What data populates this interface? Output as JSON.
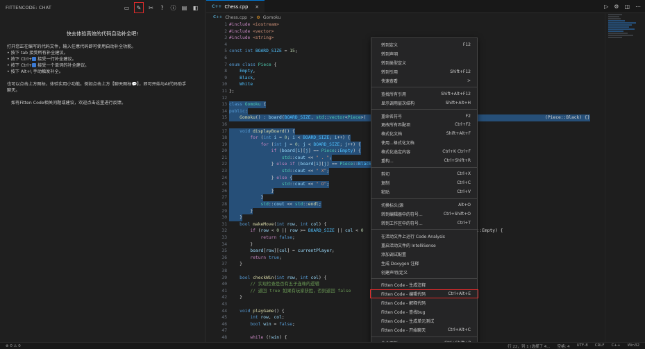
{
  "sidebar": {
    "title": "FITTENCODE: CHAT",
    "icons": [
      "chat-icon",
      "edit-icon",
      "tools-icon",
      "help-icon",
      "info-icon",
      "document-icon",
      "layout-icon"
    ],
    "welcome_title": "快去体验高效的代码自动补全吧!",
    "tips": [
      "打开您正在编写的代码文件，输入任意代码即可使用自动补全功能。",
      "• 按下 tab 接受所有补全建议。",
      "• 按下 Ctrl+",
      "• 按下 Ctrl+",
      "• 按下 Alt+\\ 手动触发补全。"
    ],
    "tip2_suffix": " 接受一行补全建议。",
    "tip3_suffix": " 接受一个单词的补全建议。",
    "feature_line1": "也可以点击上方图标，体验实用小功能。例如点击上方【聊天图标",
    "feature_line1_suffix": "】，即可开始与AI代码助手",
    "feature_line2": "聊天。",
    "feedback": "如有Fitten Code相关问题或建议，欢迎点击这里进行反馈。"
  },
  "editor": {
    "tab_icon": "C++",
    "tab_label": "Chess.cpp",
    "breadcrumb_icon": "C++",
    "breadcrumb_file": "Chess.cpp",
    "breadcrumb_sep": ">",
    "breadcrumb_symbol": "Gomoku",
    "code_tail_line15": "(Piece::Black) {}",
    "code_tail_line32": "= Piece::Empty) {"
  },
  "context_menu": {
    "items": [
      {
        "label": "转到定义",
        "key": "F12"
      },
      {
        "label": "转到声明",
        "key": ""
      },
      {
        "label": "转到类型定义",
        "key": ""
      },
      {
        "label": "转到引用",
        "key": "Shift+F12"
      },
      {
        "label": "快速查看",
        "key": ">"
      },
      {
        "sep": true
      },
      {
        "label": "查找所有引用",
        "key": "Shift+Alt+F12"
      },
      {
        "label": "显示调用层次结构",
        "key": "Shift+Alt+H"
      },
      {
        "sep": true
      },
      {
        "label": "重命名符号",
        "key": "F2"
      },
      {
        "label": "更改所有匹配项",
        "key": "Ctrl+F2"
      },
      {
        "label": "格式化文档",
        "key": "Shift+Alt+F"
      },
      {
        "label": "使用...格式化文档",
        "key": ""
      },
      {
        "label": "格式化选定内容",
        "key": "Ctrl+K Ctrl+F"
      },
      {
        "label": "重构...",
        "key": "Ctrl+Shift+R"
      },
      {
        "sep": true
      },
      {
        "label": "剪切",
        "key": "Ctrl+X"
      },
      {
        "label": "复制",
        "key": "Ctrl+C"
      },
      {
        "label": "粘贴",
        "key": "Ctrl+V"
      },
      {
        "sep": true
      },
      {
        "label": "切换标头/源",
        "key": "Alt+O"
      },
      {
        "label": "转到编辑器中的符号...",
        "key": "Ctrl+Shift+O"
      },
      {
        "label": "转到工作区中的符号...",
        "key": "Ctrl+T"
      },
      {
        "sep": true
      },
      {
        "label": "在活动文件上运行 Code Analysis",
        "key": ""
      },
      {
        "label": "重启活动文件的 IntelliSense",
        "key": ""
      },
      {
        "label": "添加调试配置",
        "key": ""
      },
      {
        "label": "生成 Doxygen 注释",
        "key": ""
      },
      {
        "label": "创建声明/定义",
        "key": ""
      },
      {
        "sep": true
      },
      {
        "label": "Fitten Code - 生成注释",
        "key": ""
      },
      {
        "label": "Fitten Code - 编辑代码",
        "key": "Ctrl+Alt+E",
        "highlight": true
      },
      {
        "label": "Fitten Code - 解释代码",
        "key": ""
      },
      {
        "label": "Fitten Code - 查找bug",
        "key": ""
      },
      {
        "label": "Fitten Code - 生成单元测试",
        "key": ""
      },
      {
        "label": "Fitten Code - 开始聊天",
        "key": "Ctrl+Alt+C"
      },
      {
        "sep": true
      },
      {
        "label": "命令面板...",
        "key": "Ctrl+Shift+P"
      }
    ]
  },
  "statusbar": {
    "left": "⊗ 0 ⚠ 0",
    "right": [
      "行 22，列 1 (选择了 4...",
      "空格: 4",
      "UTF-8",
      "CRLF",
      "C++",
      "Win32"
    ]
  },
  "colors": {
    "accent": "#0078d4",
    "highlight_box": "#e32b2b",
    "selection": "#264f78"
  }
}
